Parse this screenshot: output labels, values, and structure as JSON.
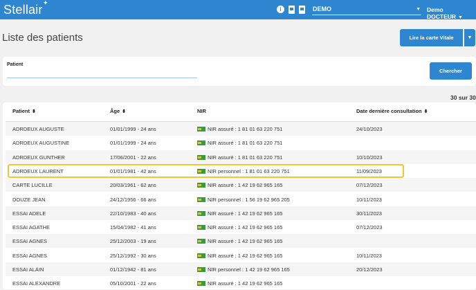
{
  "app": {
    "logo": "Stellair",
    "environment": "DEMO",
    "user": "Demo DOCTEUR"
  },
  "page": {
    "title": "Liste des patients",
    "vitale_button": "Lire la carte Vitale"
  },
  "search": {
    "label": "Patient",
    "value": "",
    "button": "Chercher"
  },
  "results": {
    "count": "30 sur 30"
  },
  "table": {
    "headers": {
      "patient": "Patient",
      "age": "Âge",
      "nir": "NIR",
      "last_consultation": "Date dernière consultation"
    },
    "rows": [
      {
        "name": "ADRDEUX AUGUSTE",
        "age": "01/01/1999 - 24 ans",
        "nir": "NIR assuré : 1 81 01 63 220 751",
        "date": "24/10/2023"
      },
      {
        "name": "ADRDEUX AUGUSTINE",
        "age": "01/01/1999 - 24 ans",
        "nir": "NIR assuré : 1 81 01 63 220 751",
        "date": ""
      },
      {
        "name": "ADRDEUX GUNTHER",
        "age": "17/06/2001 - 22 ans",
        "nir": "NIR assuré : 1 81 01 63 220 751",
        "date": "10/10/2023"
      },
      {
        "name": "ADRDEUX LAURENT",
        "age": "01/01/1981 - 42 ans",
        "nir": "NIR personnel : 1 81 01 63 220 751",
        "date": "11/09/2023"
      },
      {
        "name": "CARTE LUCILLE",
        "age": "20/03/1961 - 62 ans",
        "nir": "NIR assuré : 1 42 19 62 965 165",
        "date": "07/12/2023"
      },
      {
        "name": "DOUZE JEAN",
        "age": "24/12/1956 - 66 ans",
        "nir": "NIR personnel : 1 56 19 62 965 205",
        "date": "10/11/2023"
      },
      {
        "name": "ESSAI ADELE",
        "age": "22/10/1983 - 40 ans",
        "nir": "NIR assuré : 1 42 19 62 965 165",
        "date": "30/11/2023"
      },
      {
        "name": "ESSAI AGATHE",
        "age": "15/04/1982 - 41 ans",
        "nir": "NIR assuré : 1 42 19 62 965 165",
        "date": "07/12/2023"
      },
      {
        "name": "ESSAI AGNES",
        "age": "25/12/2003 - 19 ans",
        "nir": "NIR assuré : 1 42 19 62 965 165",
        "date": ""
      },
      {
        "name": "ESSAI AGNES",
        "age": "25/12/1992 - 30 ans",
        "nir": "NIR assuré : 1 42 19 62 965 165",
        "date": "10/11/2023"
      },
      {
        "name": "ESSAI ALAIN",
        "age": "01/12/1942 - 81 ans",
        "nir": "NIR personnel : 1 42 19 62 965 165",
        "date": "20/12/2023"
      },
      {
        "name": "ESSAI ALEXANDRE",
        "age": "05/10/2001 - 22 ans",
        "nir": "NIR assuré : 1 42 19 62 965 165",
        "date": ""
      }
    ]
  }
}
